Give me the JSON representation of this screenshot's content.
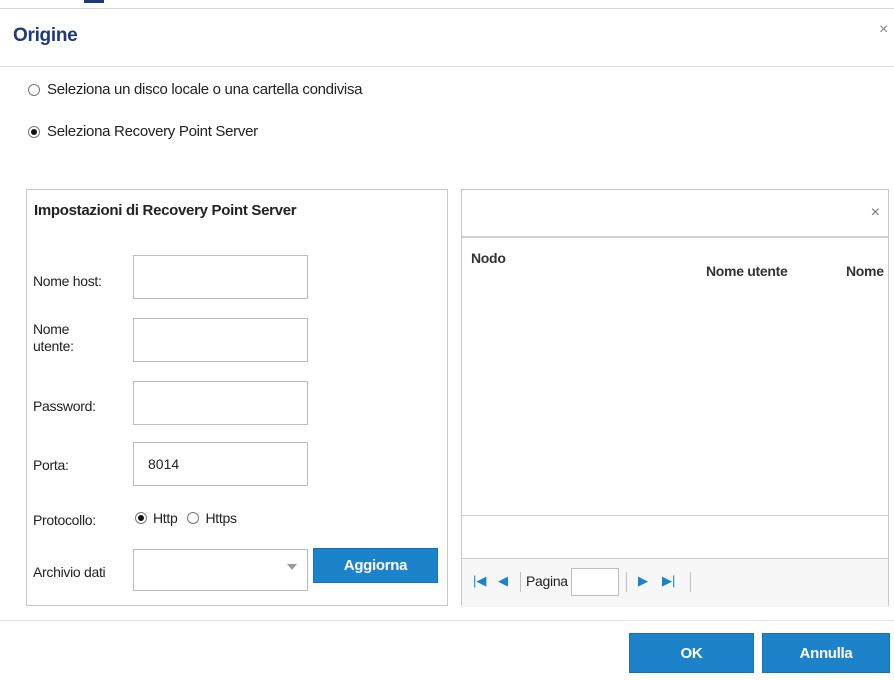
{
  "dialog": {
    "title": "Origine",
    "close_glyph": "×"
  },
  "source_options": [
    {
      "label": "Seleziona un disco locale o una cartella condivisa",
      "selected": false
    },
    {
      "label": "Seleziona Recovery Point Server",
      "selected": true
    }
  ],
  "rps_settings": {
    "title": "Impostazioni di Recovery Point Server",
    "host_label": "Nome host:",
    "host_value": "",
    "user_label_line1": "Nome",
    "user_label_line2": "utente:",
    "user_value": "",
    "password_label": "Password:",
    "password_value": "",
    "port_label": "Porta:",
    "port_value": "8014",
    "protocol_label": "Protocollo:",
    "protocol_options": [
      {
        "label": "Http",
        "selected": true
      },
      {
        "label": "Https",
        "selected": false
      }
    ],
    "datastore_label": "Archivio dati",
    "datastore_value": "",
    "refresh_button": "Aggiorna"
  },
  "node_grid": {
    "search_clear_glyph": "×",
    "columns": [
      "Nodo",
      "Nome utente",
      "Nome"
    ],
    "rows": [],
    "pager": {
      "page_label": "Pagina",
      "page_value": "",
      "first_glyph": "|◀",
      "prev_glyph": "◀",
      "next_glyph": "▶",
      "last_glyph": "▶|"
    }
  },
  "footer": {
    "ok_button": "OK",
    "cancel_button": "Annulla"
  },
  "colors": {
    "title_blue": "#1d3a78",
    "button_blue": "#1c82c9"
  }
}
